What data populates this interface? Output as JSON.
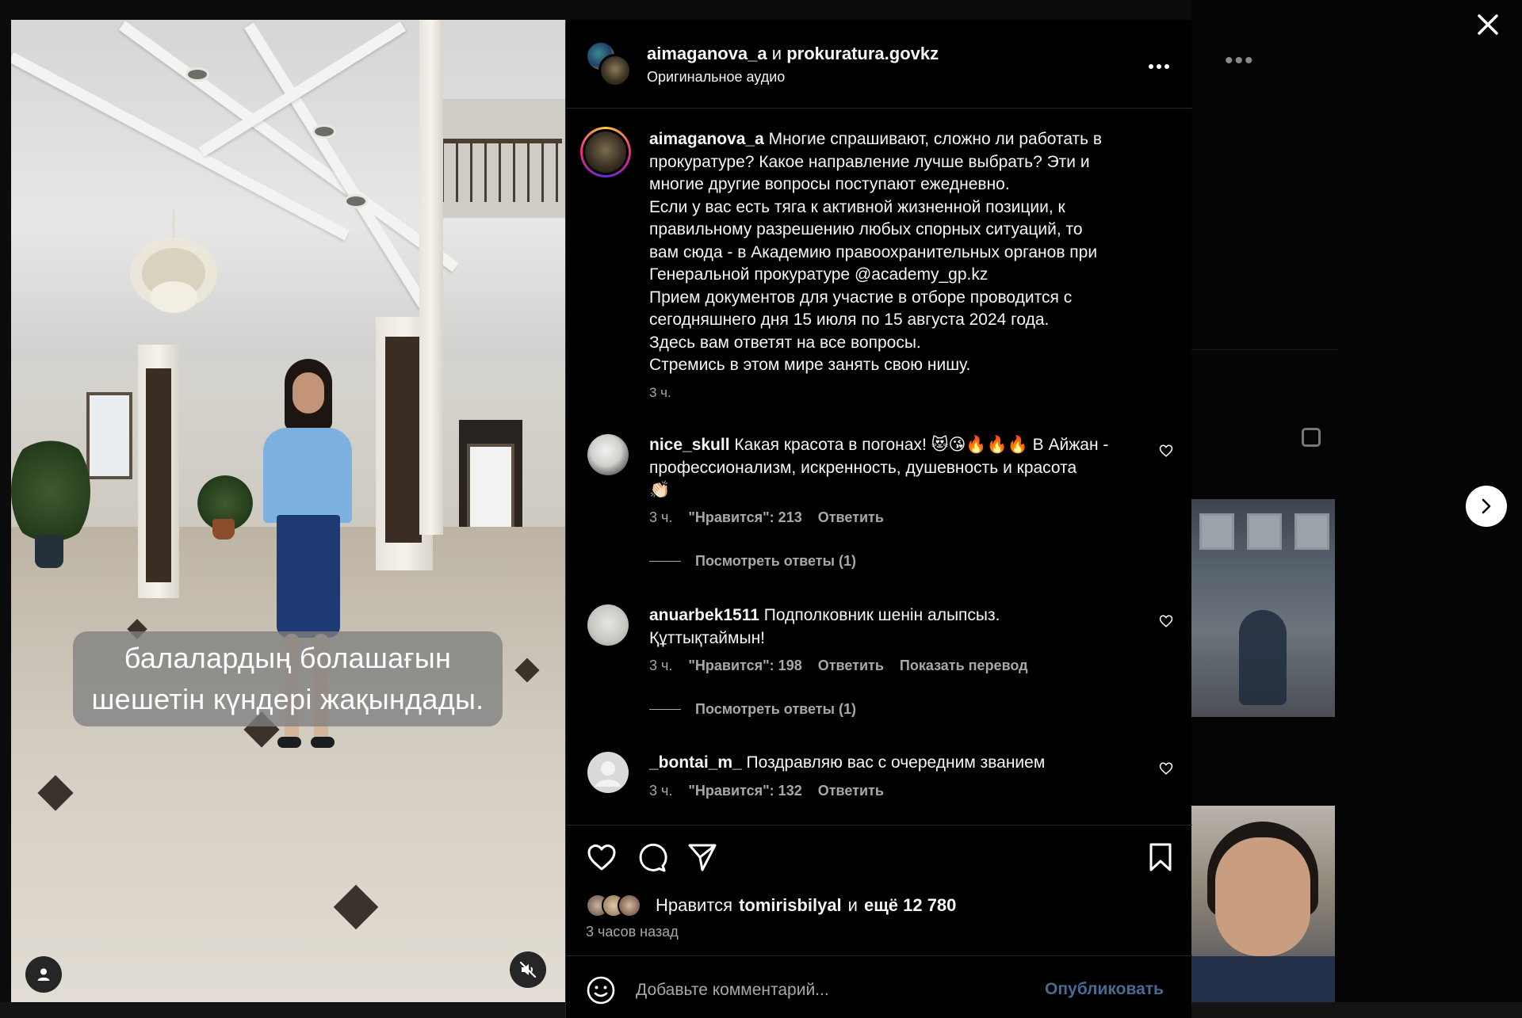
{
  "header": {
    "user1": "aimaganova_a",
    "conj": "и",
    "user2": "prokuratura.govkz",
    "audio": "Оригинальное аудио"
  },
  "caption": {
    "username": "aimaganova_a",
    "lines": [
      "Многие спрашивают, сложно ли работать в",
      "прокуратуре? Какое направление лучше выбрать? Эти и",
      "многие другие вопросы поступают ежедневно.",
      "Если у вас есть тяга к активной жизненной позиции, к",
      "правильному разрешению любых спорных ситуаций, то",
      "вам сюда - в Академию правоохранительных органов при",
      "Генеральной прокуратуре @academy_gp.kz",
      "Прием документов для участие в отборе проводится с",
      "сегодняшнего дня 15 июля по 15 августа 2024 года.",
      "Здесь вам ответят на все вопросы.",
      "Стремись в этом мире занять свою нишу."
    ],
    "time": "3 ч."
  },
  "comments": [
    {
      "username": "nice_skull",
      "text_line1": "Какая красота в погонах! 😻😘🔥🔥🔥 В Айжан -",
      "text_line2": "профессионализм, искренность, душевность и красота",
      "text_line3": "👏🏻",
      "time": "3 ч.",
      "likes": "\"Нравится\": 213",
      "reply": "Ответить",
      "view_replies": "Посмотреть ответы (1)"
    },
    {
      "username": "anuarbek1511",
      "text_line1": "Подполковник шенін алыпсыз.",
      "text_line2": "Құттықтаймын!",
      "time": "3 ч.",
      "likes": "\"Нравится\": 198",
      "reply": "Ответить",
      "translate": "Показать перевод",
      "view_replies": "Посмотреть ответы (1)"
    },
    {
      "username": "_bontai_m_",
      "text_line1": "Поздравляю вас с очередним званием",
      "time": "3 ч.",
      "likes": "\"Нравится\": 132",
      "reply": "Ответить"
    }
  ],
  "likes": {
    "prefix": "Нравится",
    "user": "tomirisbilyal",
    "conj": "и",
    "more": "ещё 12 780"
  },
  "post_time": "3 часов назад",
  "composer": {
    "placeholder": "Добавьте комментарий...",
    "publish": "Опубликовать"
  },
  "video": {
    "subtitle": "балалардың болашағын\nшешетін күндері жақындады."
  },
  "icons": {
    "close": "close-icon",
    "next": "chevron-right-icon",
    "more": "more-horizontal-icon",
    "like": "heart-icon",
    "comment": "comment-icon",
    "share": "send-icon",
    "save": "bookmark-icon",
    "emoji": "emoji-icon",
    "mute": "sound-off-icon",
    "user_tag": "user-tag-icon"
  },
  "colors": {
    "background": "#000000",
    "text": "#f5f5f5",
    "secondary_text": "#a8a8a8",
    "publish_disabled": "#4a6a8f",
    "divider": "#262626"
  }
}
